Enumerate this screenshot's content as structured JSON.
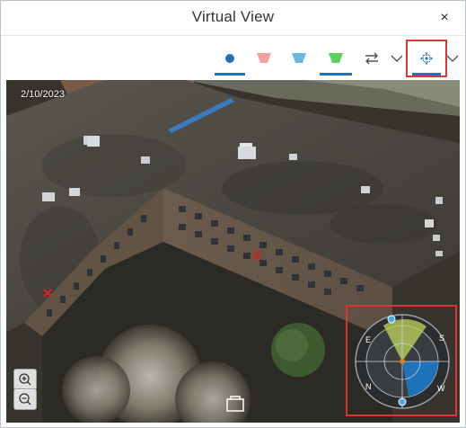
{
  "window": {
    "title": "Virtual View",
    "close_glyph": "×"
  },
  "toolbar": {
    "items": [
      {
        "name": "point-mode-icon",
        "color": "#1e73b8",
        "active": true
      },
      {
        "name": "frustum-red-icon",
        "color": "#f4a0a0",
        "active": false
      },
      {
        "name": "frustum-blue-icon",
        "color": "#6fb6e6",
        "active": false
      },
      {
        "name": "frustum-green-icon",
        "color": "#5fd05f",
        "active": true
      },
      {
        "name": "swap-icon",
        "active": false
      },
      {
        "name": "chevron-down-icon",
        "active": false
      },
      {
        "name": "pan-move-icon",
        "active": true,
        "highlighted": true
      },
      {
        "name": "chevron-down-icon",
        "active": false
      }
    ]
  },
  "view": {
    "date": "2/10/2023"
  },
  "compass": {
    "highlighted": true,
    "labels": {
      "north": "N",
      "east": "E",
      "south": "S",
      "west": "W"
    }
  },
  "colors": {
    "accent": "#1e73b8",
    "highlight": "#e03434"
  }
}
